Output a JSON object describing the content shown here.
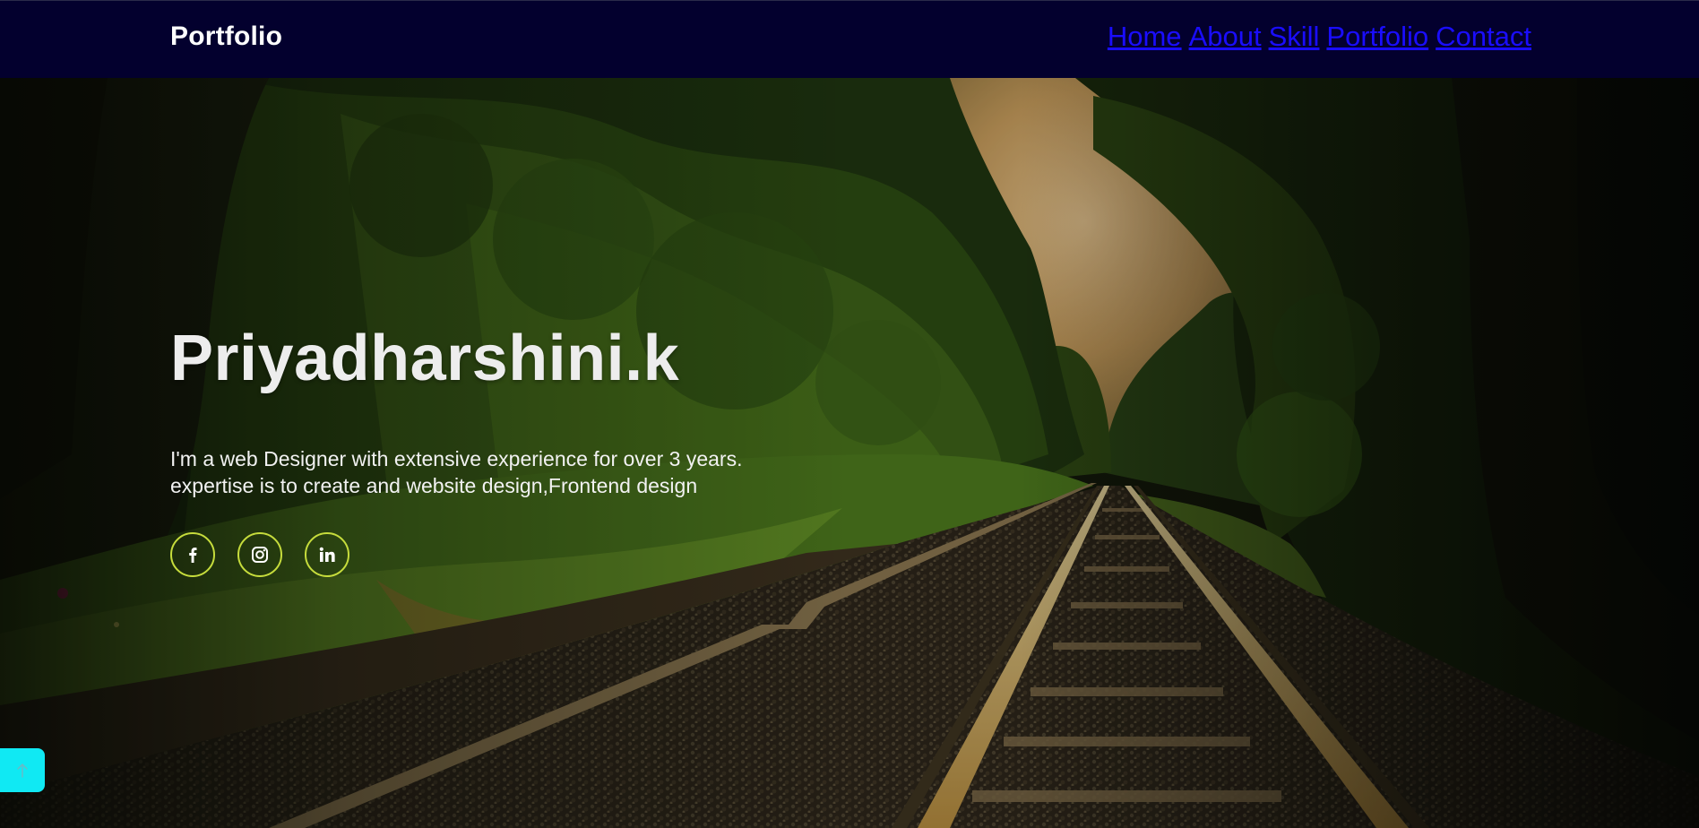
{
  "nav": {
    "brand": "Portfolio",
    "links": [
      "Home",
      "About",
      "Skill",
      "Portfolio",
      "Contact"
    ]
  },
  "hero": {
    "name": "Priyadharshini.k",
    "description_line1": "I'm a web Designer with extensive experience for over 3 years.",
    "description_line2": "expertise is to create and website design,Frontend design"
  },
  "socials": [
    {
      "icon": "facebook-icon"
    },
    {
      "icon": "instagram-icon"
    },
    {
      "icon": "linkedin-icon"
    }
  ],
  "back_to_top": {
    "icon": "arrow-up-icon"
  },
  "colors": {
    "navbar": "#03002e",
    "brand_text": "#ffffff",
    "nav_link": "#1a0dff",
    "social_ring": "#c6dc3c",
    "back_to_top": "#10e9f3"
  }
}
